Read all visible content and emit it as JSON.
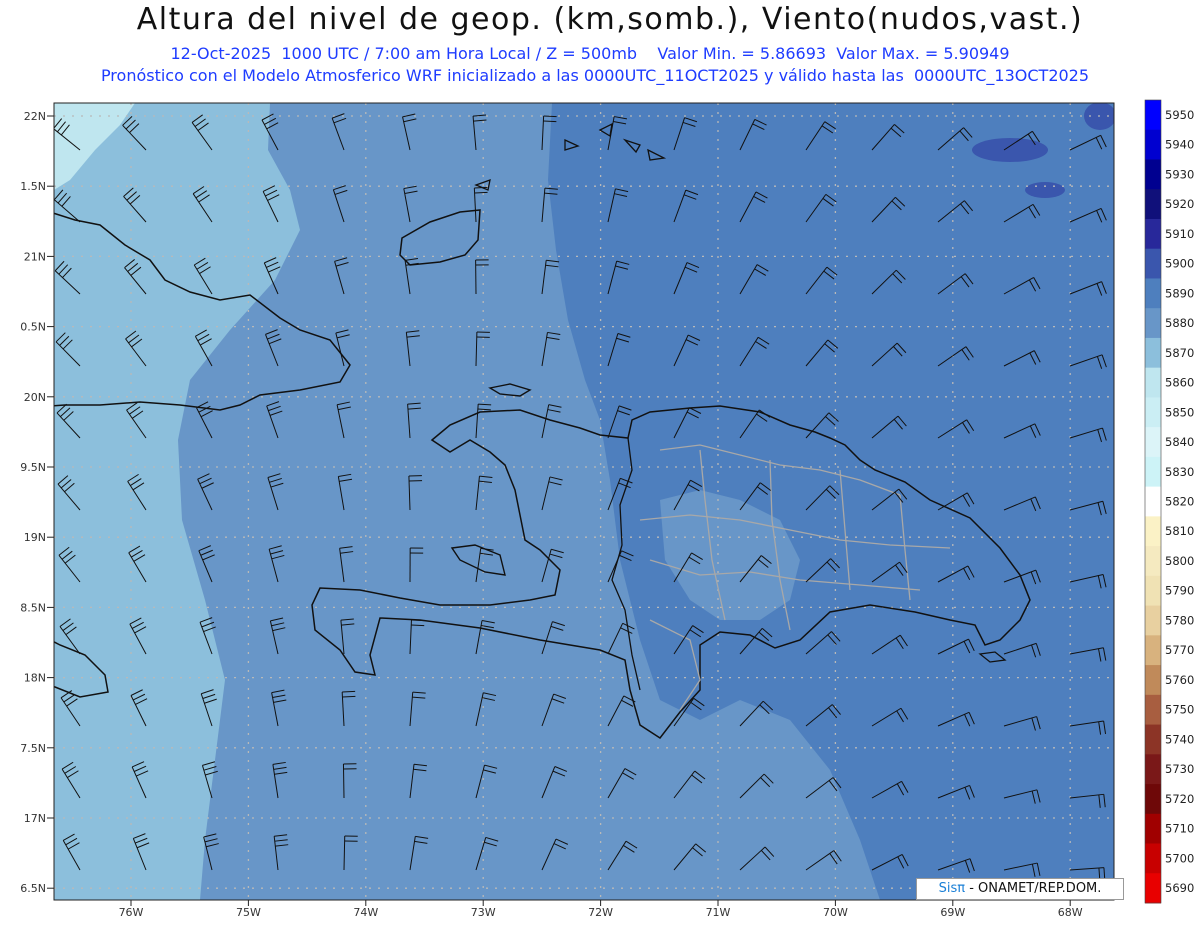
{
  "header": {
    "title": "Altura del nivel de geop. (km,somb.), Viento(nudos,vast.)",
    "line1": "12-Oct-2025  1000 UTC / 7:00 am Hora Local / Z = 500mb    Valor Min. = 5.86693  Valor Max. = 5.90949",
    "line2": "Pronóstico con el Modelo Atmosferico WRF inicializado a las 0000UTC_11OCT2025 y válido hasta las  0000UTC_13OCT2025"
  },
  "axes": {
    "lat_labels": [
      "22N",
      "1.5N",
      "21N",
      "0.5N",
      "20N",
      "9.5N",
      "19N",
      "8.5N",
      "18N",
      "7.5N",
      "17N",
      "6.5N"
    ],
    "lon_labels": [
      "76W",
      "75W",
      "74W",
      "73W",
      "72W",
      "71W",
      "70W",
      "69W",
      "68W"
    ]
  },
  "colorbar": {
    "levels": [
      5950,
      5940,
      5930,
      5920,
      5910,
      5900,
      5890,
      5880,
      5870,
      5860,
      5850,
      5840,
      5830,
      5820,
      5810,
      5800,
      5790,
      5780,
      5770,
      5760,
      5750,
      5740,
      5730,
      5720,
      5710,
      5700,
      5690
    ],
    "colors": [
      "#0000ff",
      "#0000d0",
      "#000090",
      "#10107a",
      "#28289a",
      "#3a56ad",
      "#4e7fbe",
      "#6896c8",
      "#8cbfdc",
      "#bfe6ef",
      "#cbeef4",
      "#dcf4f8",
      "#cdf3f7",
      "#ffffff",
      "#fbf2c6",
      "#f5eac0",
      "#f0e2b4",
      "#e8d0a0",
      "#d8b27e",
      "#c08a5a",
      "#a85e40",
      "#8c3426",
      "#7a1818",
      "#6e0808",
      "#a00000",
      "#c80000",
      "#e80000"
    ]
  },
  "map_colors": {
    "z5860": "#bfe6ef",
    "z5870": "#8cbfdc",
    "z5880": "#6896c8",
    "z5890": "#4e7fbe",
    "z5900": "#3a56ad"
  },
  "credit": {
    "brand": "Sisπ",
    "text": "- ONAMET/REP.DOM."
  }
}
